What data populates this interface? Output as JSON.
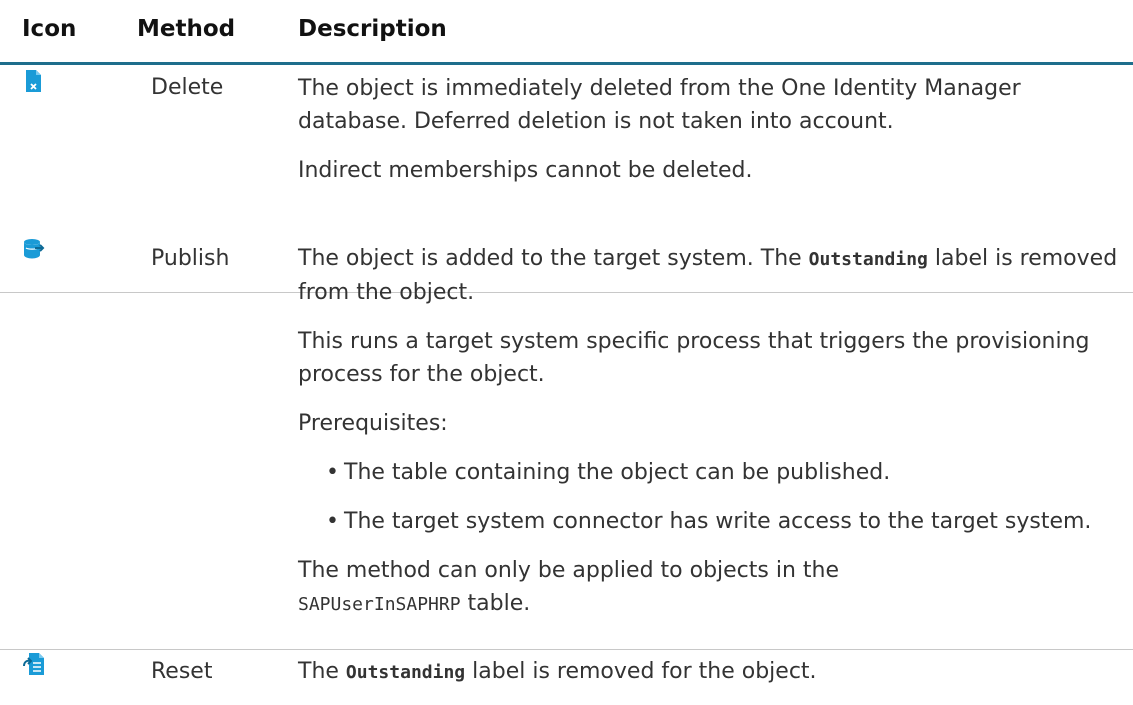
{
  "headers": {
    "icon": "Icon",
    "method": "Method",
    "description": "Description"
  },
  "rows": [
    {
      "icon": "delete-doc-icon",
      "method": "Delete",
      "desc_p1": "The object is immediately deleted from the One Identity Manager database. Deferred deletion is not taken into account.",
      "desc_p2": "Indirect memberships cannot be deleted."
    },
    {
      "icon": "publish-db-icon",
      "method": "Publish",
      "desc_p1_pre": "The object is added to the target system. The ",
      "desc_p1_code": "Outstanding",
      "desc_p1_post": " label is removed from the object.",
      "desc_p2": "This runs a target system specific process that triggers the provisioning process for the object.",
      "desc_p3": "Prerequisites:",
      "bullets": [
        "The table containing the object can be published.",
        "The target system connector has write access to the target system."
      ],
      "desc_p4_pre": "The method can only be applied to objects in the",
      "desc_p4_code": "SAPUserInSAPHRP",
      "desc_p4_post": " table."
    },
    {
      "icon": "reset-doc-icon",
      "method": "Reset",
      "desc_p1_pre": "The ",
      "desc_p1_code": "Outstanding",
      "desc_p1_post": " label is removed for the object."
    }
  ],
  "colors": {
    "header_rule": "#1e6e8c",
    "row_rule": "#c8c8c8",
    "icon_blue": "#1a9bd7"
  }
}
